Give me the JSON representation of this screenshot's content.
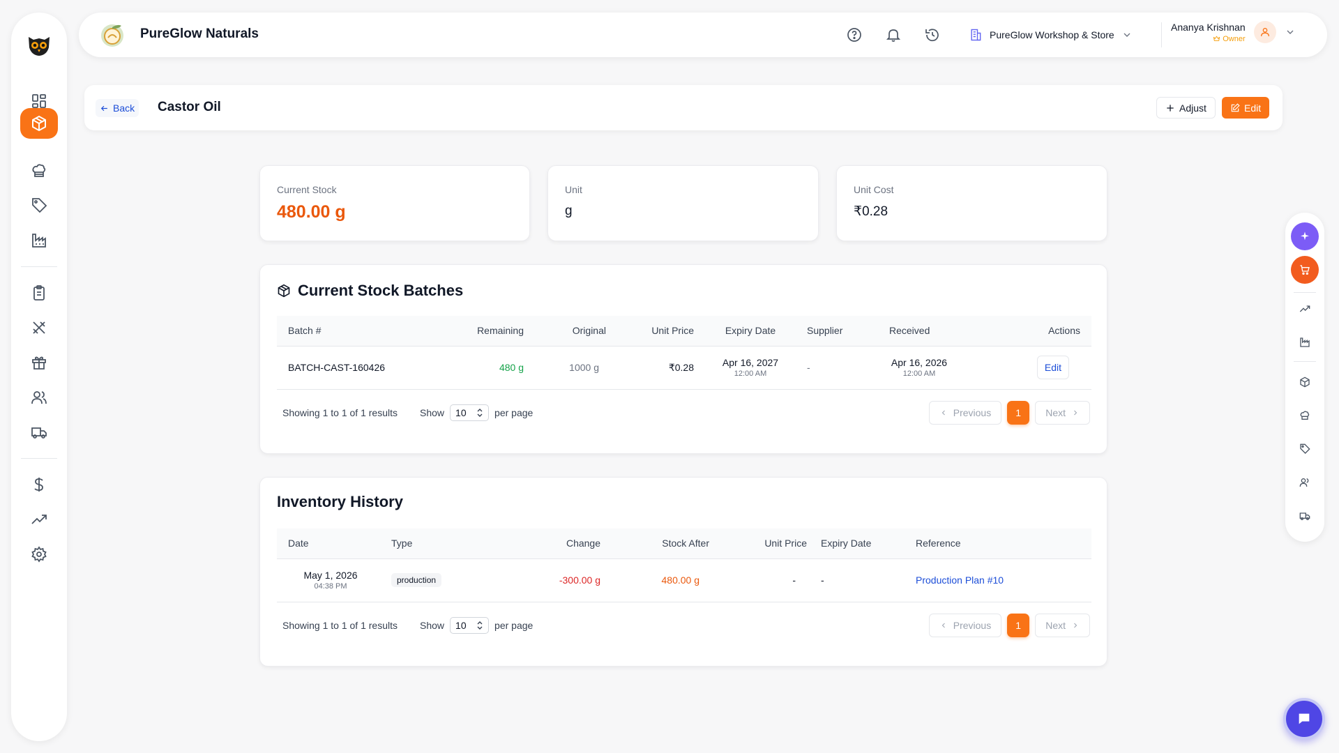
{
  "app": {
    "brand_name": "PureGlow Naturals",
    "workspace": "PureGlow Workshop & Store",
    "user_name": "Ananya Krishnan",
    "user_role": "Owner"
  },
  "page": {
    "back_label": "Back",
    "title": "Castor Oil",
    "adjust_label": "Adjust",
    "edit_label": "Edit"
  },
  "stats": {
    "current_stock_label": "Current Stock",
    "current_stock_value": "480.00 g",
    "unit_label": "Unit",
    "unit_value": "g",
    "unit_cost_label": "Unit Cost",
    "unit_cost_value": "₹0.28"
  },
  "batches": {
    "title": "Current Stock Batches",
    "columns": [
      "Batch #",
      "Remaining",
      "Original",
      "Unit Price",
      "Expiry Date",
      "Supplier",
      "Received",
      "Actions"
    ],
    "rows": [
      {
        "batch": "BATCH-CAST-160426",
        "remaining": "480 g",
        "original": "1000 g",
        "unit_price": "₹0.28",
        "expiry_date": "Apr 16, 2027",
        "expiry_time": "12:00 AM",
        "supplier": "-",
        "received_date": "Apr 16, 2026",
        "received_time": "12:00 AM",
        "action": "Edit"
      }
    ],
    "pagination": {
      "summary": "Showing 1 to 1 of 1 results",
      "show_label": "Show",
      "per_page": "10",
      "per_page_label": "per page",
      "previous": "Previous",
      "page": "1",
      "next": "Next"
    }
  },
  "history": {
    "title": "Inventory History",
    "columns": [
      "Date",
      "Type",
      "Change",
      "Stock After",
      "Unit Price",
      "Expiry Date",
      "Reference"
    ],
    "rows": [
      {
        "date": "May 1, 2026",
        "time": "04:38 PM",
        "type": "production",
        "change": "-300.00 g",
        "stock_after": "480.00 g",
        "unit_price": "-",
        "expiry_date": "-",
        "reference": "Production Plan #10"
      }
    ],
    "pagination": {
      "summary": "Showing 1 to 1 of 1 results",
      "show_label": "Show",
      "per_page": "10",
      "per_page_label": "per page",
      "previous": "Previous",
      "page": "1",
      "next": "Next"
    }
  },
  "colors": {
    "accent": "#f97316",
    "positive": "#16a34a",
    "negative": "#dc2626",
    "link": "#1d4ed8",
    "assistant": "#6d5bf3"
  },
  "icons": {
    "sidebar": [
      "logo-owl-icon",
      "dashboard-icon",
      "inventory-box-icon",
      "chef-hat-icon",
      "tag-icon",
      "factory-icon",
      "clipboard-icon",
      "tools-icon",
      "gift-icon",
      "users-icon",
      "truck-icon",
      "dollar-icon",
      "trending-up-icon",
      "settings-icon"
    ],
    "header": [
      "help-icon",
      "bell-icon",
      "history-icon",
      "building-icon",
      "chevron-down-icon",
      "user-icon"
    ],
    "dock": [
      "sparkles-icon",
      "cart-icon",
      "trending-up-icon",
      "factory-icon",
      "box-icon",
      "chef-hat-icon",
      "tag-icon",
      "users-icon",
      "truck-icon"
    ]
  }
}
